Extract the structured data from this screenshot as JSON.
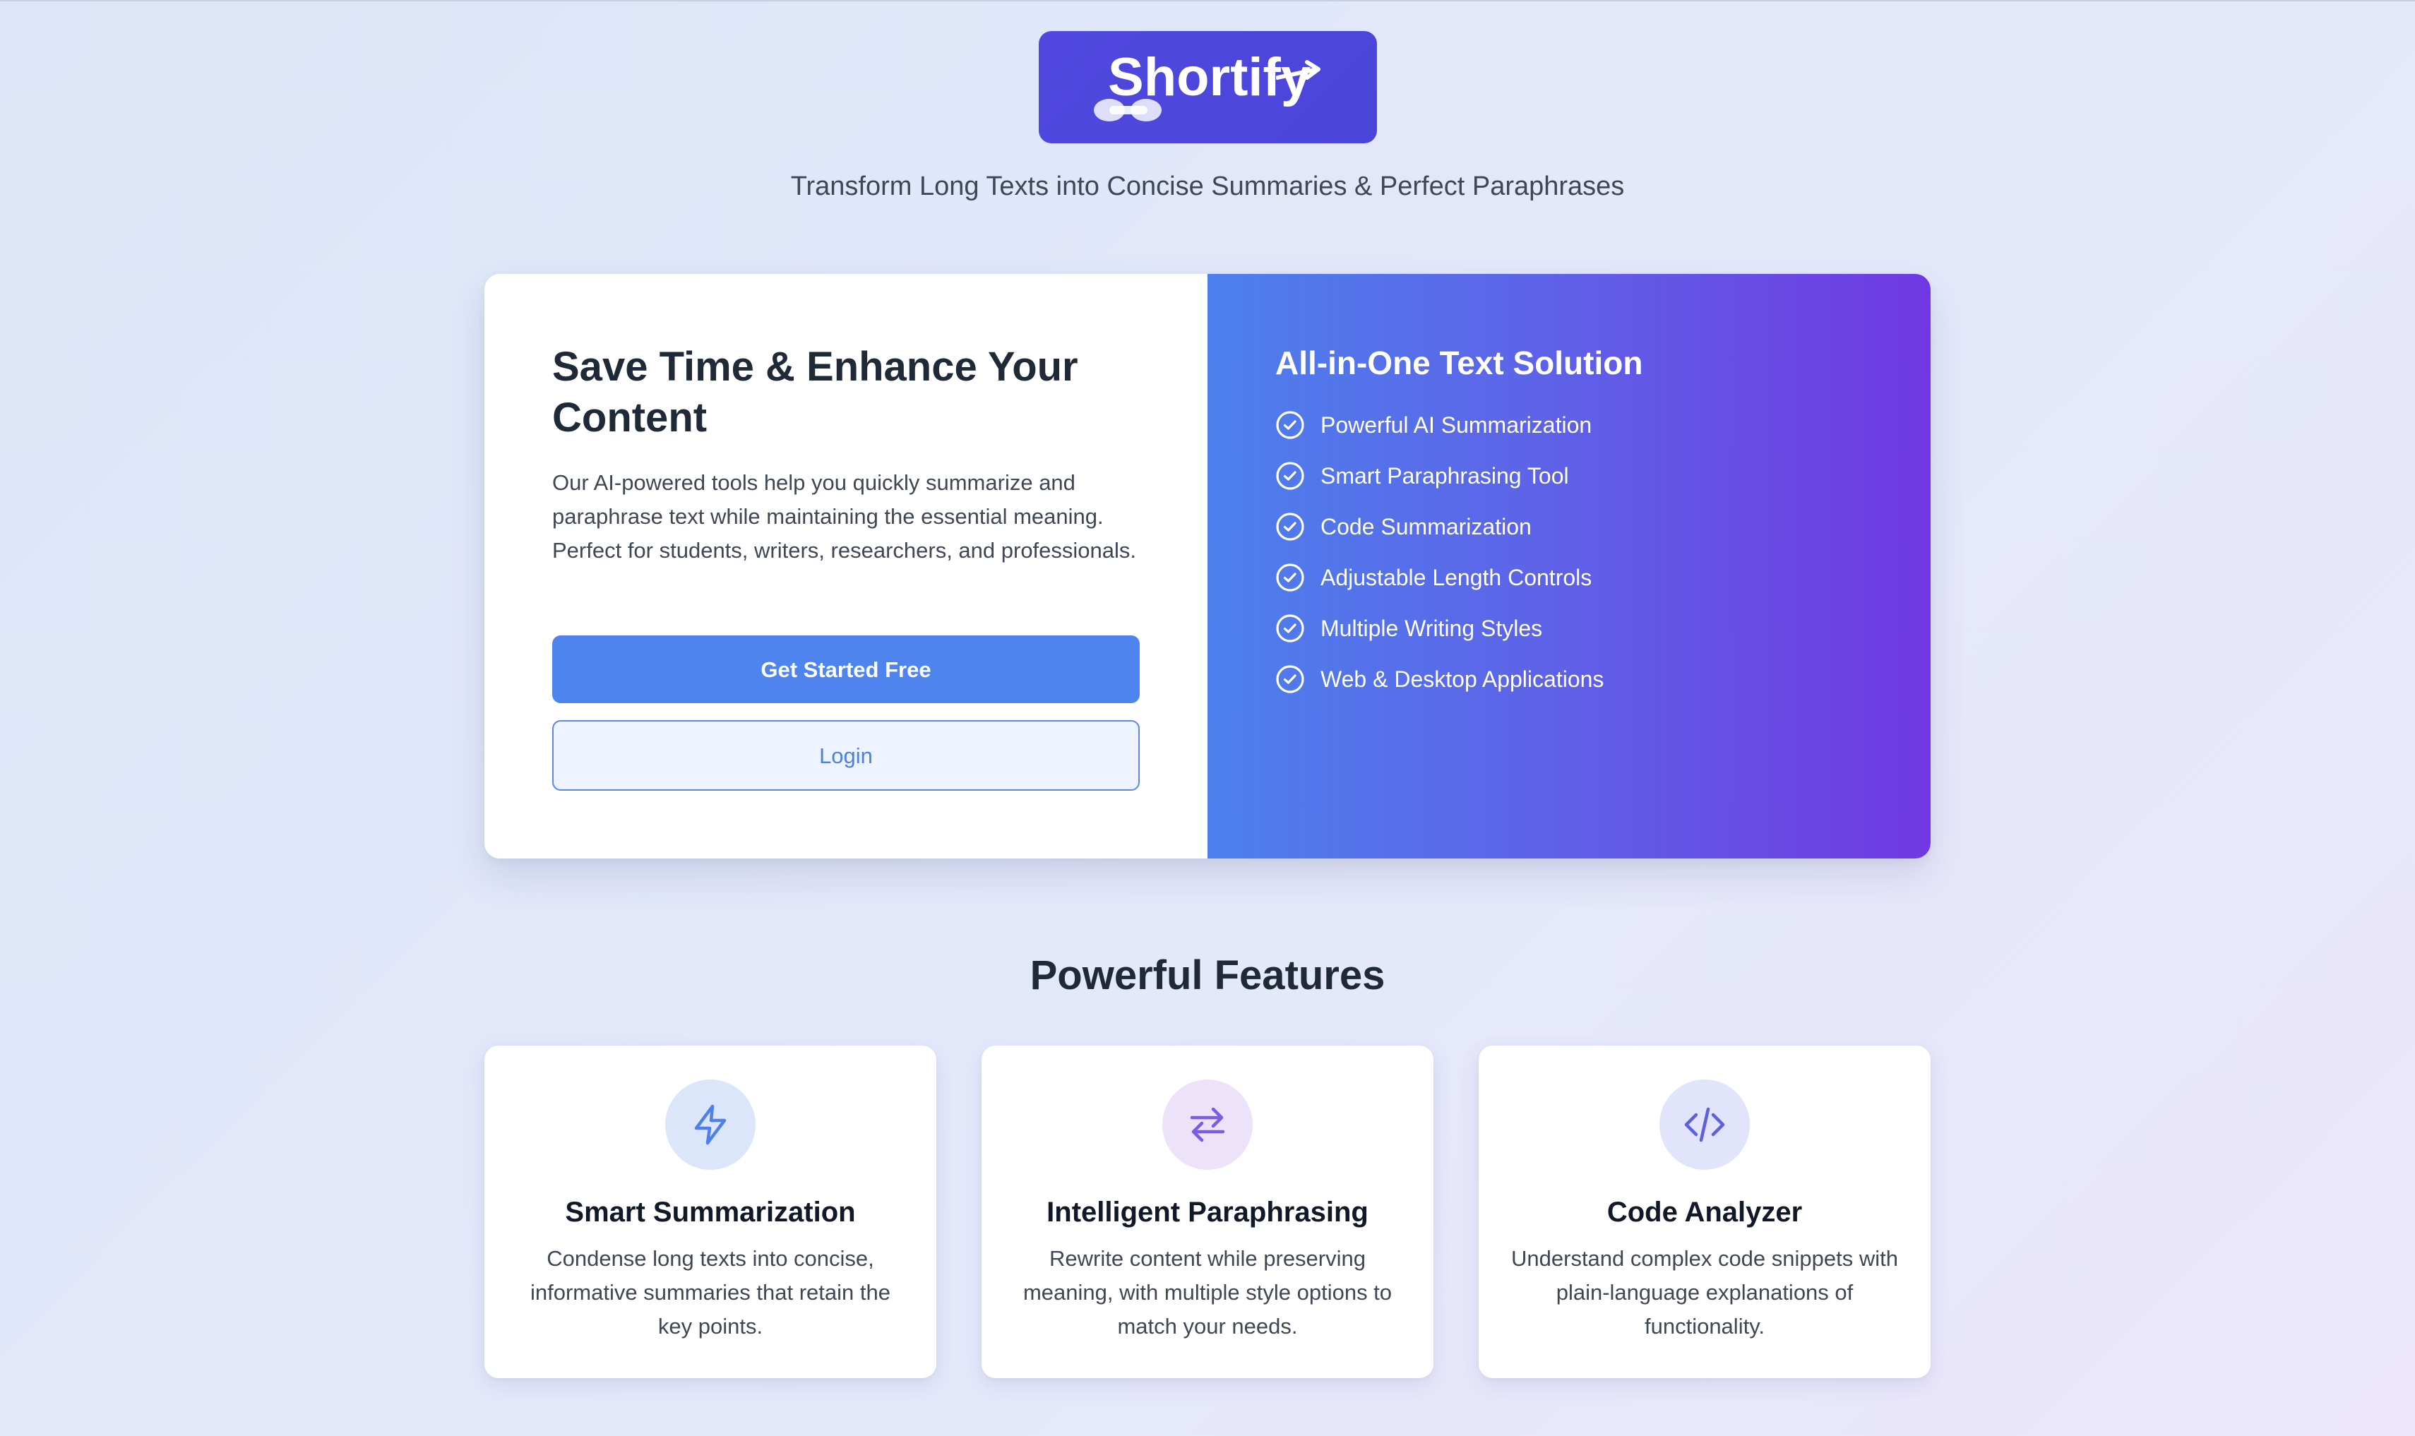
{
  "header": {
    "logo_text": "Shortify",
    "tagline": "Transform Long Texts into Concise Summaries & Perfect Paraphrases"
  },
  "hero": {
    "title": "Save Time & Enhance Your Content",
    "description": "Our AI-powered tools help you quickly summarize and paraphrase text while maintaining the essential meaning. Perfect for students, writers, researchers, and professionals.",
    "primary_button": "Get Started Free",
    "secondary_button": "Login",
    "solution_title": "All-in-One Text Solution",
    "solution_items": [
      "Powerful AI Summarization",
      "Smart Paraphrasing Tool",
      "Code Summarization",
      "Adjustable Length Controls",
      "Multiple Writing Styles",
      "Web & Desktop Applications"
    ]
  },
  "features": {
    "title": "Powerful Features",
    "cards": [
      {
        "icon": "lightning-icon",
        "title": "Smart Summarization",
        "description": "Condense long texts into concise, informative summaries that retain the key points."
      },
      {
        "icon": "swap-arrows-icon",
        "title": "Intelligent Paraphrasing",
        "description": "Rewrite content while preserving meaning, with multiple style options to match your needs."
      },
      {
        "icon": "code-icon",
        "title": "Code Analyzer",
        "description": "Understand complex code snippets with plain-language explanations of functionality."
      }
    ]
  },
  "colors": {
    "brand": "#4f46e5",
    "primary_button": "#4f84ee",
    "gradient_start": "#4d80ec",
    "gradient_end": "#7038e2",
    "icon_blue": "#4f7fe8",
    "icon_purple": "#7c5ce6",
    "icon_indigo": "#5b5fe0"
  }
}
